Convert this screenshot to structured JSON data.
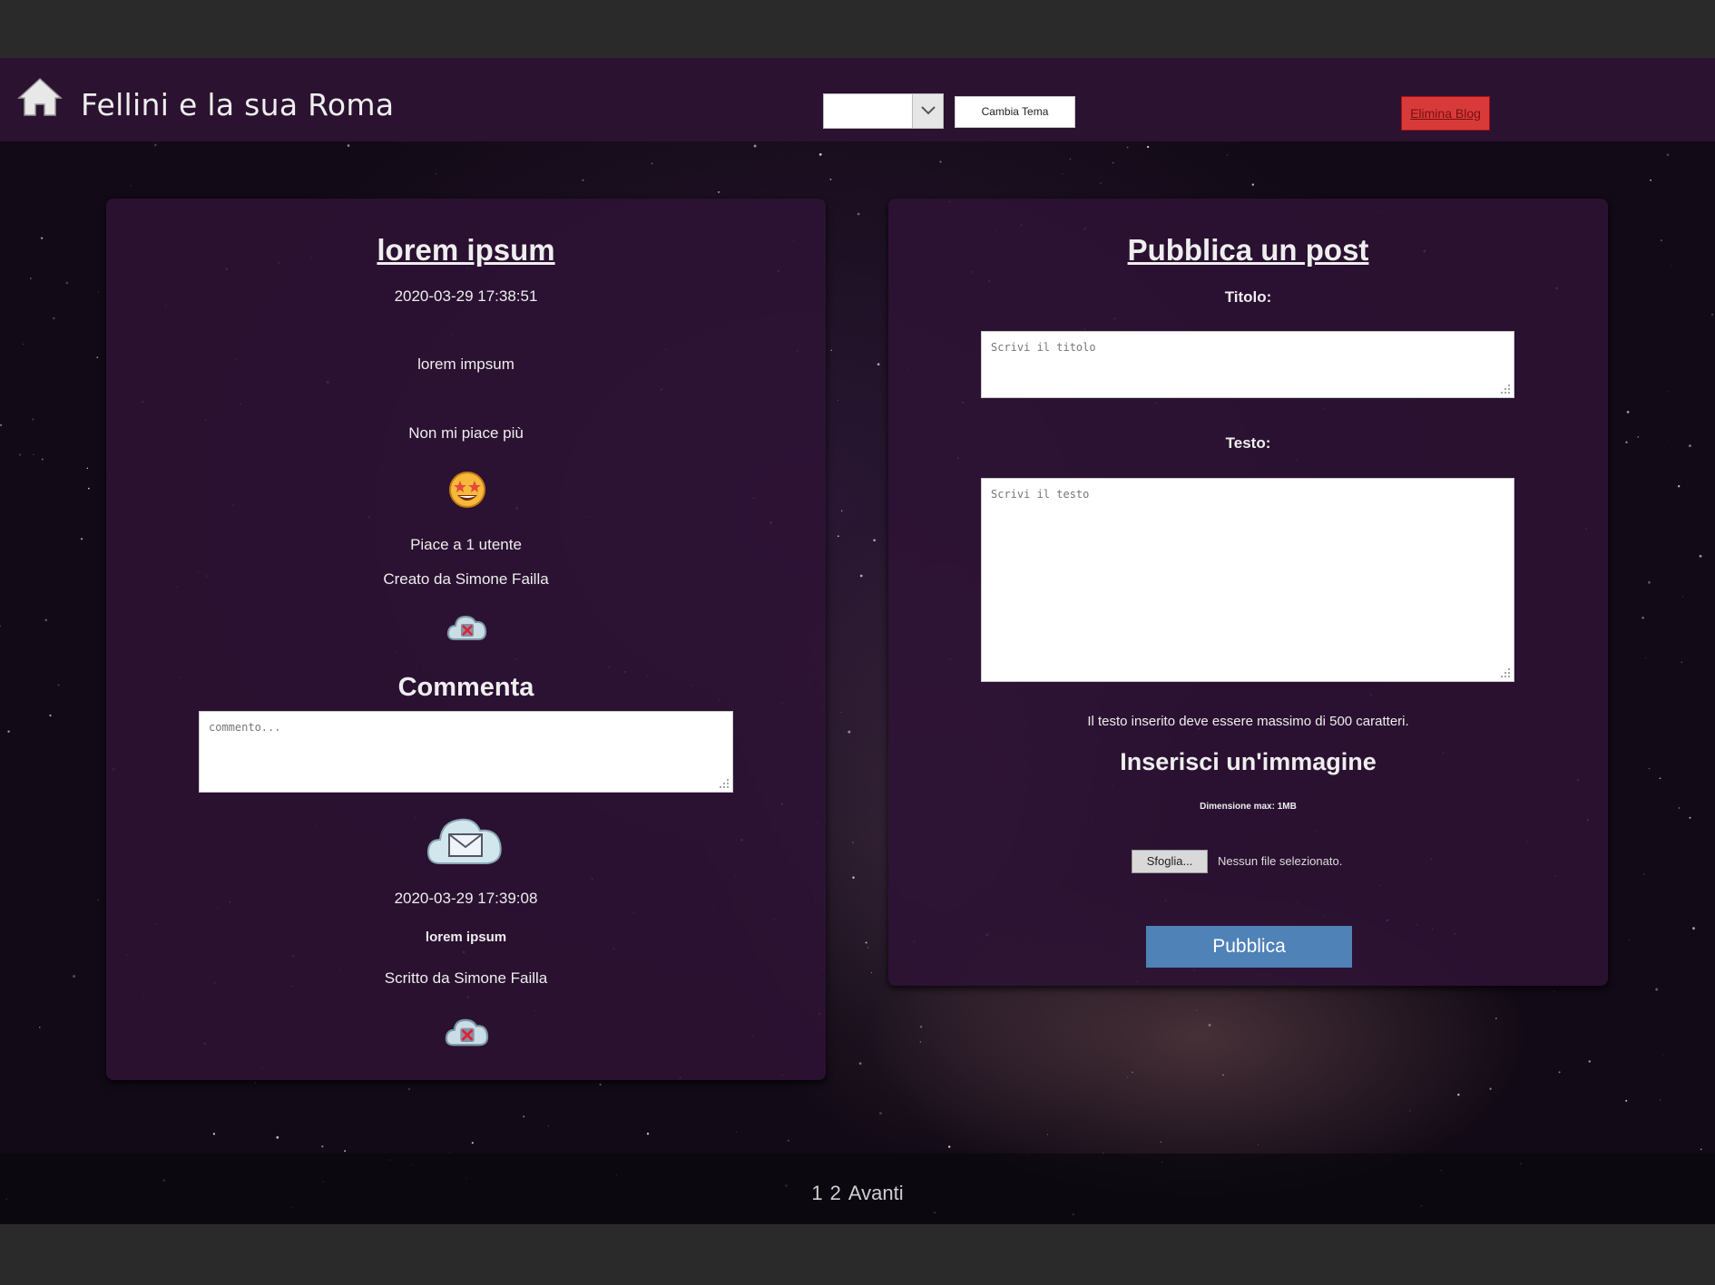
{
  "header": {
    "site_title": "Fellini e la sua Roma",
    "theme_select_value": "",
    "theme_button_label": "Cambia Tema",
    "delete_blog_label": "Elimina Blog"
  },
  "post": {
    "title": "lorem ipsum",
    "date": "2020-03-29 17:38:51",
    "body": "lorem impsum",
    "unlike_label": "Non mi piace più",
    "likes_text": "Piace a 1 utente",
    "author_text": "Creato da Simone Failla",
    "comment_heading": "Commenta",
    "comment_placeholder": "commento..."
  },
  "comment": {
    "date": "2020-03-29 17:39:08",
    "text": "lorem ipsum",
    "author_text": "Scritto da Simone Failla"
  },
  "new_post": {
    "heading": "Pubblica un post",
    "title_label": "Titolo:",
    "title_placeholder": "Scrivi il titolo",
    "text_label": "Testo:",
    "text_placeholder": "Scrivi il testo",
    "limit_note": "Il testo inserito deve essere massimo di 500 caratteri.",
    "image_heading": "Inserisci un'immagine",
    "image_note": "Dimensione max: 1MB",
    "browse_label": "Sfoglia...",
    "no_file_label": "Nessun file selezionato.",
    "publish_label": "Pubblica"
  },
  "pagination": {
    "page1": "1",
    "page2": "2",
    "next": "Avanti"
  },
  "icons": {
    "home": "home-icon",
    "emoji": "star-struck-emoji-icon",
    "delete": "cloud-delete-icon",
    "send": "cloud-envelope-send-icon",
    "dropdown": "chevron-down-icon"
  },
  "colors": {
    "topbar": "#2b1230",
    "card": "#2e1234",
    "delete_button": "#d83a3a",
    "publish_button": "#4f82b7"
  }
}
